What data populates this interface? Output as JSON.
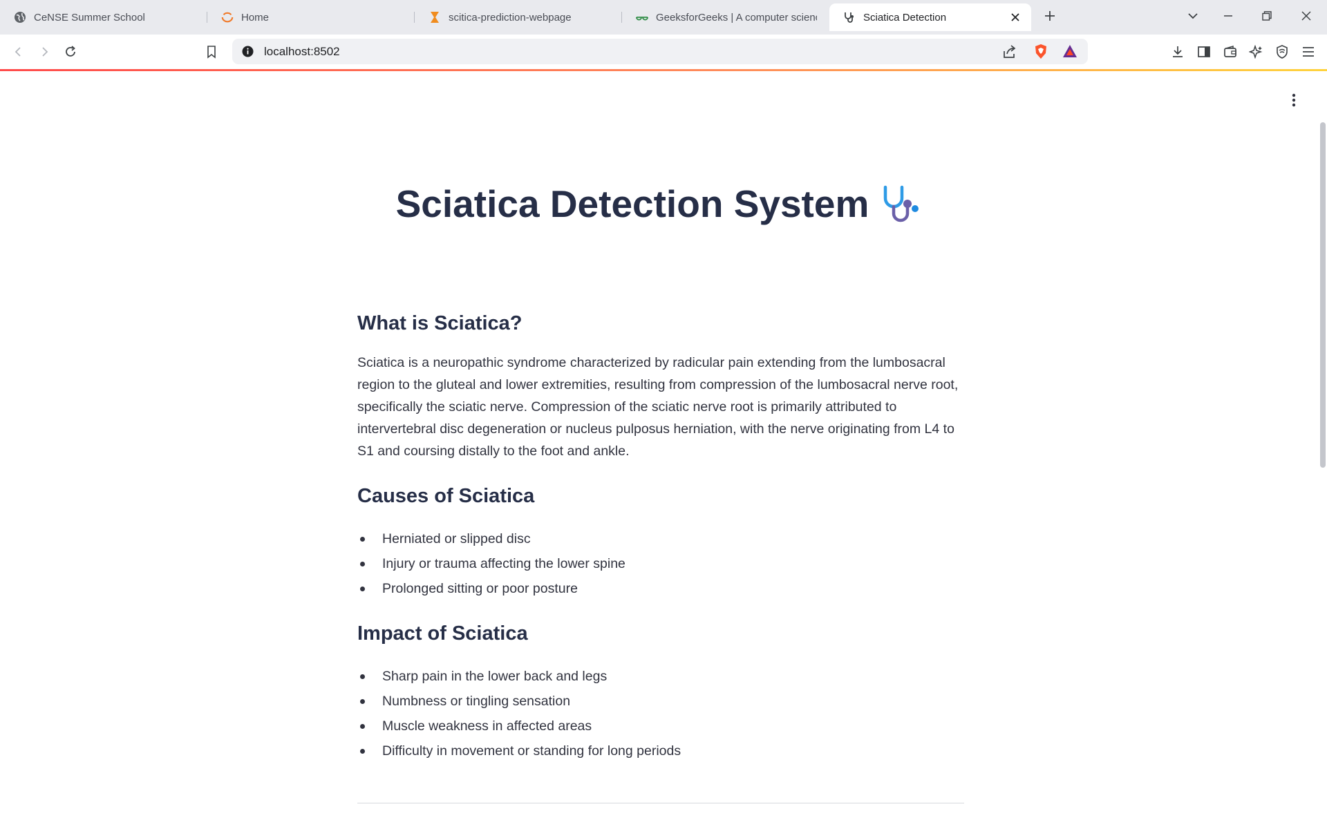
{
  "browser": {
    "tabs": [
      {
        "title": "CeNSE Summer School",
        "icon": "globe-icon"
      },
      {
        "title": "Home",
        "icon": "loading-arc-icon"
      },
      {
        "title": "scitica-prediction-webpage",
        "icon": "hourglass-icon"
      },
      {
        "title": "GeeksforGeeks | A computer science",
        "icon": "gfg-logo-icon"
      },
      {
        "title": "Sciatica Detection",
        "icon": "stethoscope-icon",
        "active": true
      }
    ],
    "address": "localhost:8502"
  },
  "colors": {
    "heading": "#262e47",
    "text": "#31333f",
    "accent_gradient_start": "#ff4b4b",
    "accent_gradient_end": "#ffd33d",
    "tabstrip_bg": "#e9eaee"
  },
  "page": {
    "title": "Sciatica Detection System",
    "title_icon": "stethoscope-icon",
    "what": {
      "heading": "What is Sciatica?",
      "body": "Sciatica is a neuropathic syndrome characterized by radicular pain extending from the lumbosacral region to the gluteal and lower extremities, resulting from compression of the lumbosacral nerve root, specifically the sciatic nerve. Compression of the sciatic nerve root is primarily attributed to intervertebral disc degeneration or nucleus pulposus herniation, with the nerve originating from L4 to S1 and coursing distally to the foot and ankle."
    },
    "causes": {
      "heading": "Causes of Sciatica",
      "items": [
        "Herniated or slipped disc",
        "Injury or trauma affecting the lower spine",
        "Prolonged sitting or poor posture"
      ]
    },
    "impact": {
      "heading": "Impact of Sciatica",
      "items": [
        "Sharp pain in the lower back and legs",
        "Numbness or tingling sensation",
        "Muscle weakness in affected areas",
        "Difficulty in movement or standing for long periods"
      ]
    }
  }
}
